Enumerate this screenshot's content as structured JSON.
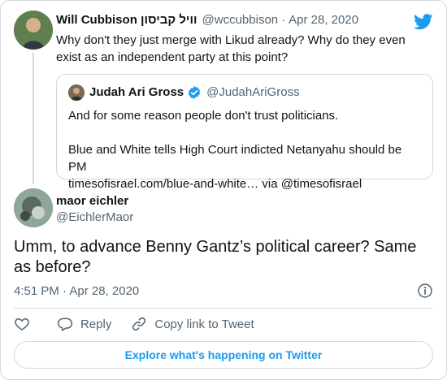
{
  "parent_tweet": {
    "author_name": "Will Cubbison וויל קביסון",
    "author_handle": "@wccubbison",
    "separator": "·",
    "date": "Apr 28, 2020",
    "text": "Why don't they just merge with Likud already? Why do they even exist as an independent party at this point?"
  },
  "quoted_tweet": {
    "author_name": "Judah Ari Gross",
    "author_handle": "@JudahAriGross",
    "line1": "And for some reason people don't trust politicians.",
    "line2": "Blue and White tells High Court indicted Netanyahu should be PM",
    "line3": "timesofisrael.com/blue-and-white… via @timesofisrael"
  },
  "main_tweet": {
    "author_name": "maor eichler",
    "author_handle": "@EichlerMaor",
    "text": "Umm, to advance Benny Gantz’s political career? Same as before?",
    "timestamp": "4:51 PM · Apr 28, 2020"
  },
  "actions": {
    "reply_label": "Reply",
    "copy_link_label": "Copy link to Tweet"
  },
  "explore_label": "Explore what's happening on Twitter",
  "icons": {
    "twitter_logo": "twitter-bird-icon",
    "verified": "verified-badge-icon",
    "info": "info-icon",
    "like": "heart-icon",
    "reply": "reply-bubble-icon",
    "copy_link": "link-icon"
  },
  "colors": {
    "accent": "#1d9bf0",
    "muted_text": "#536471",
    "border": "#cfd9de",
    "text": "#0f1419"
  }
}
